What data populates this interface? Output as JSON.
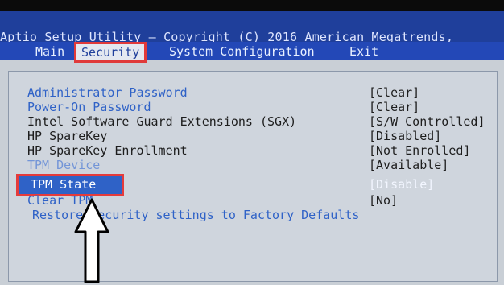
{
  "app": {
    "title": "Aptio Setup Utility – Copyright (C) 2016 American Megatrends,"
  },
  "tabs": [
    {
      "label": "Main"
    },
    {
      "label": "Security",
      "selected": true
    },
    {
      "label": "System Configuration"
    },
    {
      "label": "Exit"
    }
  ],
  "settings": [
    {
      "label": "Administrator Password",
      "value": "[Clear]"
    },
    {
      "label": "Power-On Password",
      "value": "[Clear]"
    },
    {
      "label": "Intel Software Guard Extensions (SGX)",
      "value": "[S/W Controlled]"
    },
    {
      "label": "HP SpareKey",
      "value": "[Disabled]"
    },
    {
      "label": "HP SpareKey Enrollment",
      "value": "[Not Enrolled]"
    },
    {
      "label": "TPM Device",
      "value": "[Available]"
    },
    {
      "label": "TPM State",
      "value": "[Disable]"
    },
    {
      "label": "Clear TPM",
      "value": "[No]"
    },
    {
      "label": "Restore Security settings to Factory Defaults",
      "value": ""
    }
  ],
  "colors": {
    "header": "#1f3f9b",
    "tab_bar": "#2348b7",
    "annotation": "#e03a3a",
    "text_blue": "#2f62c7"
  }
}
